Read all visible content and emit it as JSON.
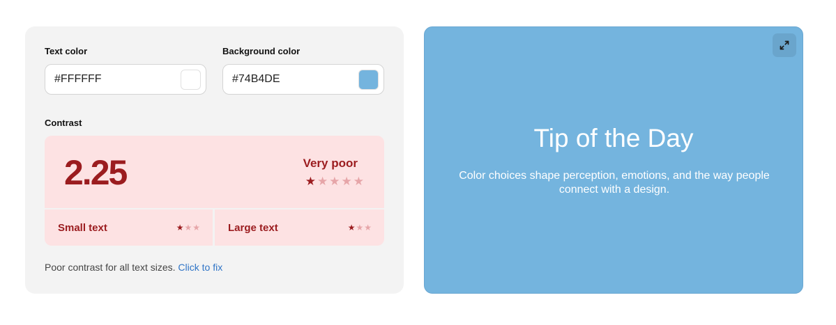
{
  "text_color": {
    "label": "Text color",
    "value": "#FFFFFF",
    "swatch_color": "#FFFFFF"
  },
  "background_color": {
    "label": "Background color",
    "value": "#74B4DE",
    "swatch_color": "#74B4DE"
  },
  "contrast": {
    "label": "Contrast",
    "ratio": "2.25",
    "rating_label": "Very poor",
    "rating_stars": 1,
    "rating_stars_max": 5,
    "small_text": {
      "label": "Small text",
      "stars": 1,
      "stars_max": 3
    },
    "large_text": {
      "label": "Large text",
      "stars": 1,
      "stars_max": 3
    }
  },
  "footnote": {
    "message": "Poor contrast for all text sizes.",
    "link_label": "Click to fix"
  },
  "preview": {
    "title": "Tip of the Day",
    "body": "Color choices shape perception, emotions, and the way people connect with a design.",
    "expand_icon": "expand-icon"
  },
  "colors": {
    "panel_bg": "#F3F3F3",
    "contrast_bg": "#FDE2E3",
    "contrast_text": "#9B1C1F",
    "star_off": "#E6A5A8",
    "link": "#2F74C6"
  }
}
